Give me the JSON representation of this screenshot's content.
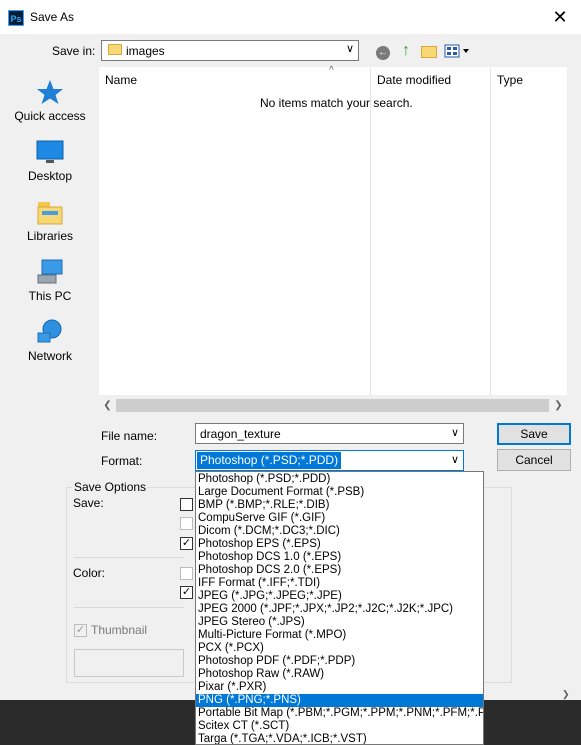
{
  "window": {
    "title": "Save As",
    "app_icon_text": "Ps",
    "close_label": "✕"
  },
  "save_in": {
    "label": "Save in:",
    "value": "images"
  },
  "places": [
    {
      "label": "Quick access",
      "icon": "star-icon"
    },
    {
      "label": "Desktop",
      "icon": "desktop-icon"
    },
    {
      "label": "Libraries",
      "icon": "libraries-icon"
    },
    {
      "label": "This PC",
      "icon": "this-pc-icon"
    },
    {
      "label": "Network",
      "icon": "network-icon"
    }
  ],
  "file_list": {
    "columns": [
      "Name",
      "Date modified",
      "Type"
    ],
    "empty_message": "No items match your search."
  },
  "file_name": {
    "label": "File name:",
    "value": "dragon_texture"
  },
  "format": {
    "label": "Format:",
    "value": "Photoshop (*.PSD;*.PDD)",
    "options": [
      "Photoshop (*.PSD;*.PDD)",
      "Large Document Format (*.PSB)",
      "BMP (*.BMP;*.RLE;*.DIB)",
      "CompuServe GIF (*.GIF)",
      "Dicom (*.DCM;*.DC3;*.DIC)",
      "Photoshop EPS (*.EPS)",
      "Photoshop DCS 1.0 (*.EPS)",
      "Photoshop DCS 2.0 (*.EPS)",
      "IFF Format (*.IFF;*.TDI)",
      "JPEG (*.JPG;*.JPEG;*.JPE)",
      "JPEG 2000 (*.JPF;*.JPX;*.JP2;*.J2C;*.J2K;*.JPC)",
      "JPEG Stereo (*.JPS)",
      "Multi-Picture Format (*.MPO)",
      "PCX (*.PCX)",
      "Photoshop PDF (*.PDF;*.PDP)",
      "Photoshop Raw (*.RAW)",
      "Pixar (*.PXR)",
      "PNG (*.PNG;*.PNS)",
      "Portable Bit Map (*.PBM;*.PGM;*.PPM;*.PNM;*.PFM;*.PAM)",
      "Scitex CT (*.SCT)",
      "Targa (*.TGA;*.VDA;*.ICB;*.VST)"
    ],
    "highlighted": "PNG (*.PNG;*.PNS)"
  },
  "buttons": {
    "save": "Save",
    "cancel": "Cancel"
  },
  "save_options": {
    "title": "Save Options",
    "save_label": "Save:",
    "color_label": "Color:",
    "thumbnail_label": "Thumbnail",
    "checkmark": "✓"
  },
  "colors": {
    "accent": "#0078d7",
    "taskbar": "#2b2b2b",
    "dialog_bg": "#f0f0f0"
  }
}
